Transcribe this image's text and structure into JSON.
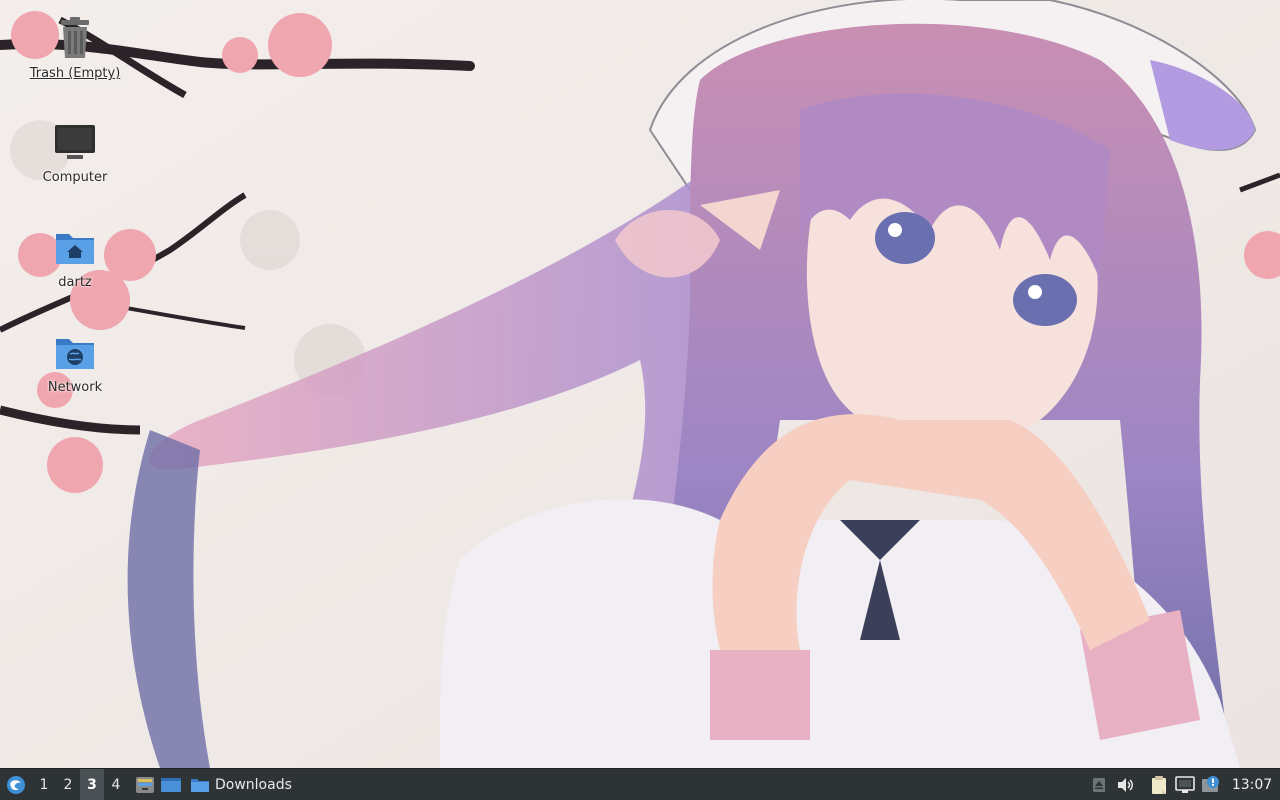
{
  "desktop": {
    "icons": [
      {
        "label": "Trash (Empty)",
        "icon": "trash-icon"
      },
      {
        "label": "Computer",
        "icon": "computer-icon"
      },
      {
        "label": "dartz",
        "icon": "home-folder-icon"
      },
      {
        "label": "Network",
        "icon": "network-folder-icon"
      }
    ],
    "wallpaper": "anime-girl-with-cherry-blossoms"
  },
  "taskbar": {
    "start_icon": "start-menu-icon",
    "workspaces": [
      "1",
      "2",
      "3",
      "4"
    ],
    "active_workspace": "3",
    "quick_launch": [
      {
        "icon": "file-manager-icon"
      },
      {
        "icon": "show-desktop-icon"
      }
    ],
    "task": {
      "icon": "folder-icon",
      "label": "Downloads"
    },
    "tray": [
      {
        "icon": "eject-icon"
      },
      {
        "icon": "volume-icon"
      },
      {
        "icon": "clipboard-icon"
      },
      {
        "icon": "network-status-icon"
      },
      {
        "icon": "update-notifier-icon"
      }
    ],
    "clock": "13:07"
  },
  "colors": {
    "taskbar_bg": "#2e3436",
    "folder_blue": "#4a90d9",
    "active_workspace_bg": "#4a5154"
  }
}
